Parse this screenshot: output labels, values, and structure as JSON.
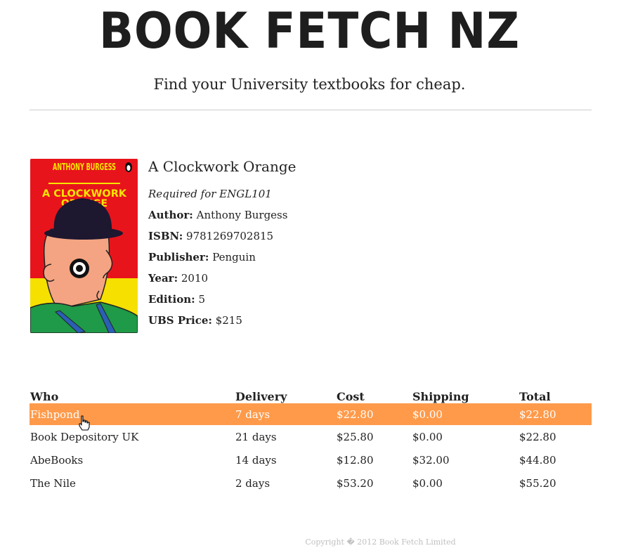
{
  "header": {
    "logo": "BOOK FETCH NZ",
    "tagline": "Find your University textbooks for cheap."
  },
  "book": {
    "cover_text": {
      "author": "ANTHONY BURGESS",
      "title_line1": "A CLOCKWORK",
      "title_line2": "ORANGE"
    },
    "title": "A Clockwork Orange",
    "required_for": "Required for ENGL101",
    "author_label": "Author:",
    "author": "Anthony Burgess",
    "isbn_label": "ISBN:",
    "isbn": "9781269702815",
    "publisher_label": "Publisher:",
    "publisher": "Penguin",
    "year_label": "Year:",
    "year": "2010",
    "edition_label": "Edition:",
    "edition": "5",
    "price_label": "UBS Price:",
    "price": "$215"
  },
  "table": {
    "headers": {
      "who": "Who",
      "delivery": "Delivery",
      "cost": "Cost",
      "shipping": "Shipping",
      "total": "Total"
    },
    "rows": [
      {
        "who": "Fishpond",
        "delivery": "7 days",
        "cost": "$22.80",
        "shipping": "$0.00",
        "total": "$22.80"
      },
      {
        "who": "Book Depository UK",
        "delivery": "21 days",
        "cost": "$25.80",
        "shipping": "$0.00",
        "total": "$22.80"
      },
      {
        "who": "AbeBooks",
        "delivery": "14 days",
        "cost": "$12.80",
        "shipping": "$32.00",
        "total": "$44.80"
      },
      {
        "who": "The Nile",
        "delivery": "2 days",
        "cost": "$53.20",
        "shipping": "$0.00",
        "total": "$55.20"
      }
    ],
    "highlight_color": "#ff9a4a"
  },
  "footer": {
    "copyright": "Copyright � 2012 Book Fetch Limited"
  }
}
